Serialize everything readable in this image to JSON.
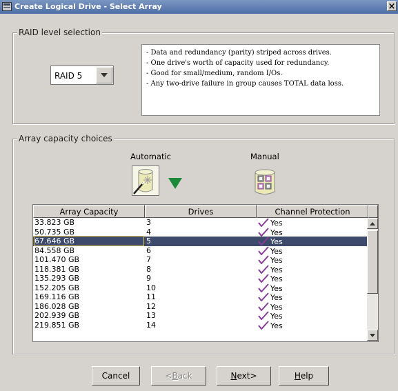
{
  "window": {
    "title": "Create Logical Drive - Select Array",
    "close_glyph": "×"
  },
  "raid_section": {
    "legend": "RAID level selection",
    "selected_level": "RAID 5",
    "description_lines": [
      "- Data and redundancy (parity) striped across drives.",
      "- One drive's worth of capacity used for redundancy.",
      "- Good for small/medium, random I/Os.",
      "- Any two-drive failure in group causes TOTAL data loss."
    ]
  },
  "capacity_section": {
    "legend": "Array capacity choices",
    "automatic_label": "Automatic",
    "manual_label": "Manual",
    "automatic_icon": "wizard-wand-icon",
    "manual_icon": "drive-array-icon",
    "table": {
      "columns": [
        "Array Capacity",
        "Drives",
        "Channel Protection"
      ],
      "selected_index": 2,
      "rows": [
        {
          "capacity": "33.823 GB",
          "drives": "3",
          "protection": "Yes"
        },
        {
          "capacity": "50.735 GB",
          "drives": "4",
          "protection": "Yes"
        },
        {
          "capacity": "67.646 GB",
          "drives": "5",
          "protection": "Yes"
        },
        {
          "capacity": "84.558 GB",
          "drives": "6",
          "protection": "Yes"
        },
        {
          "capacity": "101.470 GB",
          "drives": "7",
          "protection": "Yes"
        },
        {
          "capacity": "118.381 GB",
          "drives": "8",
          "protection": "Yes"
        },
        {
          "capacity": "135.293 GB",
          "drives": "9",
          "protection": "Yes"
        },
        {
          "capacity": "152.205 GB",
          "drives": "10",
          "protection": "Yes"
        },
        {
          "capacity": "169.116 GB",
          "drives": "11",
          "protection": "Yes"
        },
        {
          "capacity": "186.028 GB",
          "drives": "12",
          "protection": "Yes"
        },
        {
          "capacity": "202.939 GB",
          "drives": "13",
          "protection": "Yes"
        },
        {
          "capacity": "219.851 GB",
          "drives": "14",
          "protection": "Yes"
        }
      ]
    }
  },
  "buttons": {
    "cancel": "Cancel",
    "back": {
      "prefix": "<",
      "mnemonic": "B",
      "rest": "ack"
    },
    "next": {
      "mnemonic": "N",
      "rest": "ext>"
    },
    "help": {
      "mnemonic": "H",
      "rest": "elp"
    }
  },
  "colors": {
    "title_bar": "#4e6ea7",
    "selection": "#3d4a6b",
    "check_mark": "#8a3a9a",
    "dropdown_arrow": "#1a8a3a"
  }
}
